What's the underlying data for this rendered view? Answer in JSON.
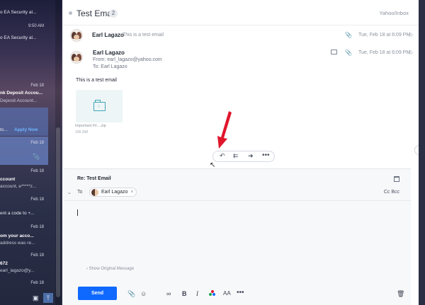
{
  "sidebar": {
    "items": [
      {
        "line1": "o EA Security al...",
        "line2": "",
        "date": ""
      },
      {
        "line1": "",
        "line2": "",
        "date": "9:50 AM"
      },
      {
        "line1": "o EA Security al...",
        "line2": "",
        "date": ""
      },
      {
        "line1": "nk Deposit Accou...",
        "line2": "Deposit Account...",
        "date": "Feb 18"
      },
      {
        "line1": "to...",
        "apply": "Apply Now",
        "date": ""
      },
      {
        "line1": "",
        "line2": "",
        "date": "Feb 18"
      },
      {
        "line1": "ccount",
        "line2": "account, e*****z...",
        "date": "Feb 18"
      },
      {
        "line1": "",
        "line2": "",
        "date": "Feb 18"
      },
      {
        "line1": "ent a code to +...",
        "line2": "",
        "date": "Feb 18"
      },
      {
        "line1": "om your acco...",
        "line2": "address was re...",
        "date": "Feb 18"
      },
      {
        "line1": "672",
        "line2": "earl_lagazo@y...",
        "date": "Feb 18"
      },
      {
        "line1": "",
        "line2": "",
        "date": "Feb 18"
      }
    ]
  },
  "thread": {
    "subject": "Test Email",
    "count": "2",
    "folder": "Yahoo/Inbox"
  },
  "message1": {
    "from": "Earl Lagazo",
    "snippet": "This is a test email",
    "date": "Tue, Feb 18 at 6:09 PM"
  },
  "message2": {
    "from": "Earl Lagazo",
    "from_line": "From: earl_lagazo@yahoo.com",
    "to_line": "To: Earl Lagazo",
    "date": "Tue, Feb 18 at 6:09 PM",
    "body": "This is a test email",
    "attachment": {
      "name": "Important Fil....zip",
      "size": "338.2kB"
    }
  },
  "composer": {
    "subject": "Re: Test Email",
    "to_label": "To",
    "recipient": "Earl Lagazo",
    "cc_bcc": "Cc Bcc",
    "show_original": "Show Original Message",
    "send_label": "Send"
  },
  "colors": {
    "accent": "#0f69ff",
    "arrow": "#e0162b"
  }
}
